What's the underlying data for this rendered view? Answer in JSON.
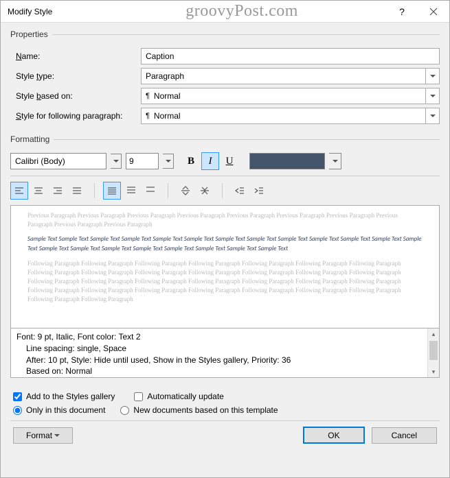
{
  "titlebar": {
    "title": "Modify Style",
    "watermark": "groovyPost.com"
  },
  "properties": {
    "legend": "Properties",
    "name_label_pre": "",
    "name_label_u": "N",
    "name_label_post": "ame:",
    "name_value": "Caption",
    "type_label_pre": "Style ",
    "type_label_u": "t",
    "type_label_post": "ype:",
    "type_value": "Paragraph",
    "based_label_pre": "Style ",
    "based_label_u": "b",
    "based_label_post": "ased on:",
    "based_value": "Normal",
    "follow_label_pre": "",
    "follow_label_u": "S",
    "follow_label_post": "tyle for following paragraph:",
    "follow_value": "Normal"
  },
  "formatting": {
    "legend": "Formatting",
    "font": "Calibri (Body)",
    "size": "9",
    "bold": "B",
    "italic": "I",
    "underline": "U",
    "color": "#44546a"
  },
  "preview": {
    "prev": "Previous Paragraph Previous Paragraph Previous Paragraph Previous Paragraph Previous Paragraph Previous Paragraph Previous Paragraph Previous Paragraph Previous Paragraph Previous Paragraph",
    "sample": "Sample Text Sample Text Sample Text Sample Text Sample Text Sample Text Sample Text Sample Text Sample Text Sample Text Sample Text Sample Text Sample Text Sample Text Sample Text Sample Text Sample Text Sample Text Sample Text Sample Text Sample Text",
    "follow": "Following Paragraph Following Paragraph Following Paragraph Following Paragraph Following Paragraph Following Paragraph Following Paragraph Following Paragraph Following Paragraph Following Paragraph Following Paragraph Following Paragraph Following Paragraph Following Paragraph Following Paragraph Following Paragraph Following Paragraph Following Paragraph Following Paragraph Following Paragraph Following Paragraph Following Paragraph Following Paragraph Following Paragraph Following Paragraph Following Paragraph Following Paragraph Following Paragraph Following Paragraph Following Paragraph"
  },
  "desc": {
    "line1": "Font: 9 pt, Italic, Font color: Text 2",
    "line2": "Line spacing:  single, Space",
    "line3": "After:  10 pt, Style: Hide until used, Show in the Styles gallery, Priority: 36",
    "line4": "Based on: Normal"
  },
  "options": {
    "add_gallery_pre": "Add to the ",
    "add_gallery_u": "S",
    "add_gallery_post": "tyles gallery",
    "auto_update_pre": "A",
    "auto_update_u": "u",
    "auto_update_post": "tomatically update",
    "only_doc_pre": "Only in this ",
    "only_doc_u": "d",
    "only_doc_post": "ocument",
    "new_docs": "New documents based on this template",
    "add_gallery_checked": true,
    "auto_update_checked": false,
    "scope": "document"
  },
  "footer": {
    "format_pre": "F",
    "format_u": "o",
    "format_post": "rmat",
    "ok": "OK",
    "cancel": "Cancel"
  }
}
